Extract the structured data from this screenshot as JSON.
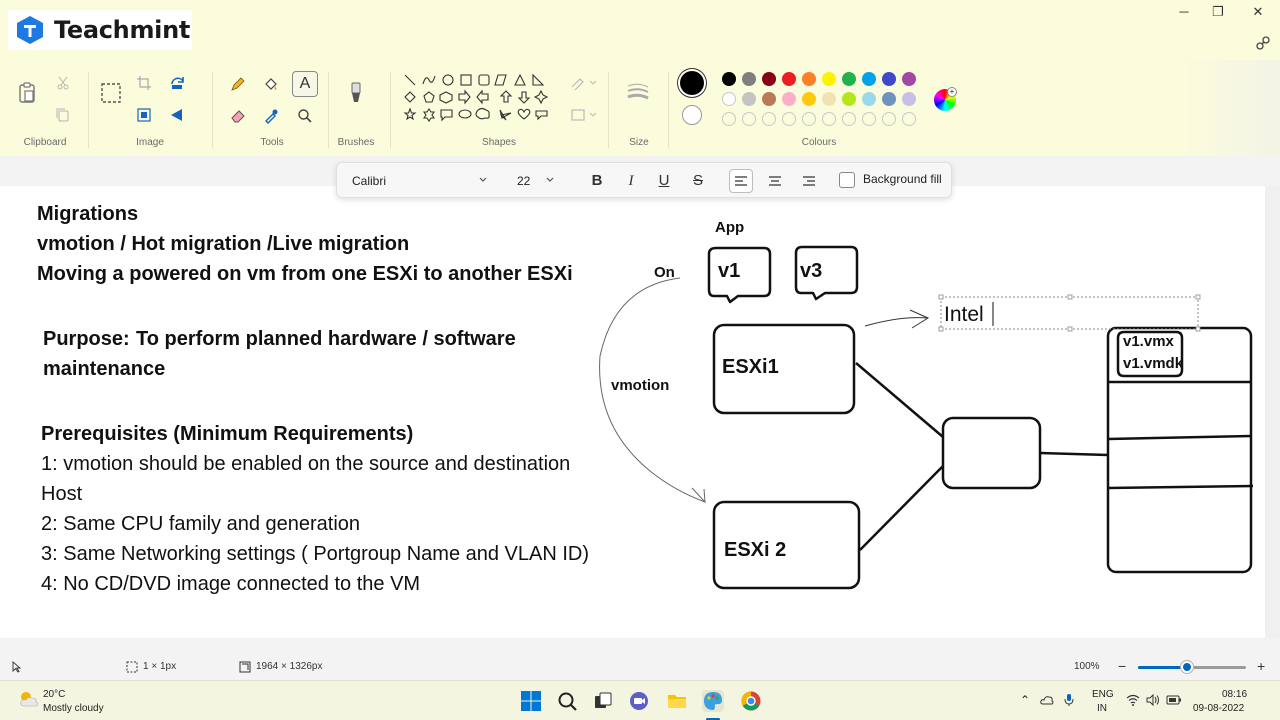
{
  "app": {
    "brand": "Teachmint"
  },
  "ribbon": {
    "groups": {
      "clipboard": "Clipboard",
      "image": "Image",
      "tools": "Tools",
      "brushes": "Brushes",
      "shapes": "Shapes",
      "size": "Size",
      "colours": "Colours"
    },
    "colours": {
      "row1": [
        "#000000",
        "#7f7f7f",
        "#880015",
        "#ed1c24",
        "#ff7f27",
        "#fff200",
        "#22b14c",
        "#00a2e8",
        "#3f48cc",
        "#a349a4"
      ],
      "row2": [
        "#ffffff",
        "#c3c3c3",
        "#b97a57",
        "#ffaec9",
        "#ffc90e",
        "#efe4b0",
        "#b5e61d",
        "#99d9ea",
        "#7092be",
        "#c8bfe7"
      ]
    }
  },
  "textbar": {
    "font_family": "Calibri",
    "font_size": "22",
    "bold": "B",
    "italic": "I",
    "underline": "U",
    "strike": "S",
    "background_fill": "Background fill"
  },
  "canvas": {
    "heading": [
      "Migrations",
      "vmotion / Hot migration /Live migration",
      "Moving a powered on vm from one ESXi to another ESXi"
    ],
    "purpose_label": "Purpose:",
    "purpose_text": "To perform planned hardware / software",
    "purpose_text2": "maintenance",
    "prereq_title": "Prerequisites (Minimum Requirements)",
    "prereqs": [
      "1: vmotion should be enabled on the source and destination",
      "Host",
      "2: Same CPU family and generation",
      "3: Same Networking settings ( Portgroup Name and VLAN ID)",
      "4: No CD/DVD image connected to the VM"
    ],
    "diagram": {
      "app_label": "App",
      "on_label": "On",
      "vm1": "v1",
      "vm3": "v3",
      "host1": "ESXi1",
      "host2": "ESXi 2",
      "vmotion_label": "vmotion",
      "text_input": "Intel",
      "file1": "v1.vmx",
      "file2": "v1.vmdk"
    }
  },
  "status": {
    "selection": "1 × 1px",
    "image_size": "1964 × 1326px",
    "zoom": "100%",
    "zoom_level": 0.45
  },
  "taskbar": {
    "weather_temp": "20°C",
    "weather_desc": "Mostly cloudy",
    "lang1": "ENG",
    "lang2": "IN",
    "time": "08:16",
    "date": "09-08-2022"
  }
}
